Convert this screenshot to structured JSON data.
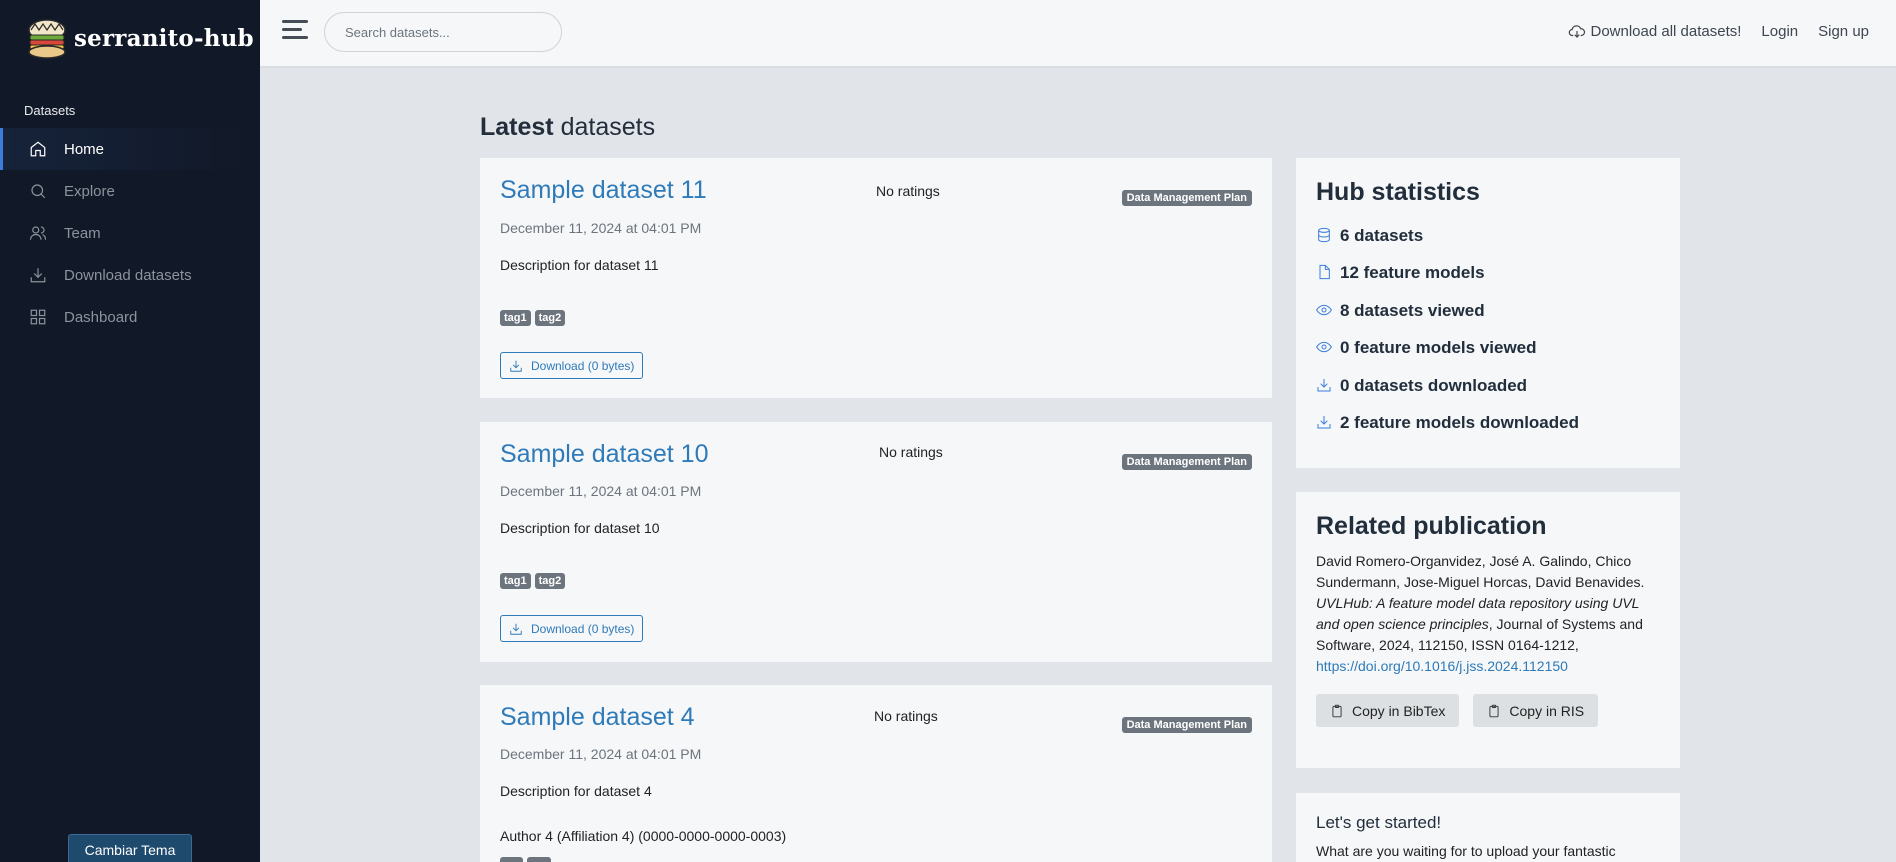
{
  "brand": {
    "name": "serranito-hub"
  },
  "sidebar": {
    "header": "Datasets",
    "items": [
      {
        "label": "Home",
        "icon": "home-icon",
        "active": true
      },
      {
        "label": "Explore",
        "icon": "search-icon",
        "active": false
      },
      {
        "label": "Team",
        "icon": "users-icon",
        "active": false
      },
      {
        "label": "Download datasets",
        "icon": "download-icon",
        "active": false
      },
      {
        "label": "Dashboard",
        "icon": "grid-icon",
        "active": false
      }
    ],
    "theme_button": "Cambiar Tema"
  },
  "navbar": {
    "search_placeholder": "Search datasets...",
    "download_all": "Download all datasets!",
    "login": "Login",
    "signup": "Sign up"
  },
  "main": {
    "title_bold": "Latest",
    "title_rest": " datasets",
    "datasets": [
      {
        "title": "Sample dataset 11",
        "rating": "No ratings",
        "badge": "Data Management Plan",
        "date": "December 11, 2024 at 04:01 PM",
        "description": "Description for dataset 11",
        "tags": [
          "tag1",
          "tag2"
        ],
        "download": "Download (0 bytes)"
      },
      {
        "title": "Sample dataset 10",
        "rating": "No ratings",
        "badge": "Data Management Plan",
        "date": "December 11, 2024 at 04:01 PM",
        "description": "Description for dataset 10",
        "tags": [
          "tag1",
          "tag2"
        ],
        "download": "Download (0 bytes)"
      },
      {
        "title": "Sample dataset 4",
        "rating": "No ratings",
        "badge": "Data Management Plan",
        "date": "December 11, 2024 at 04:01 PM",
        "description": "Description for dataset 4",
        "author": "Author 4 (Affiliation 4) (0000-0000-0000-0003)"
      }
    ]
  },
  "stats": {
    "title": "Hub statistics",
    "items": [
      {
        "icon": "database-icon",
        "text": "6 datasets"
      },
      {
        "icon": "file-icon",
        "text": "12 feature models"
      },
      {
        "icon": "eye-icon",
        "text": "8 datasets viewed"
      },
      {
        "icon": "eye-icon",
        "text": "0 feature models viewed"
      },
      {
        "icon": "download-icon",
        "text": "0 datasets downloaded"
      },
      {
        "icon": "download-icon",
        "text": "2 feature models downloaded"
      }
    ]
  },
  "publication": {
    "title": "Related publication",
    "authors": "David Romero-Organvidez, José A. Galindo, Chico Sundermann, Jose-Miguel Horcas, David Benavides.",
    "paper_title": "UVLHub: A feature model data repository using UVL and open science principles",
    "journal": ", Journal of Systems and Software, 2024, 112150, ISSN 0164-1212,",
    "doi": "https://doi.org/10.1016/j.jss.2024.112150",
    "copy_bibtex": "Copy in BibTex",
    "copy_ris": "Copy in RIS"
  },
  "get_started": {
    "title": "Let's get started!",
    "text": "What are you waiting for to upload your fantastic"
  },
  "colors": {
    "accent": "#3b7ddd",
    "link": "#2f7ab8",
    "sidebar_bg": "#111827"
  }
}
